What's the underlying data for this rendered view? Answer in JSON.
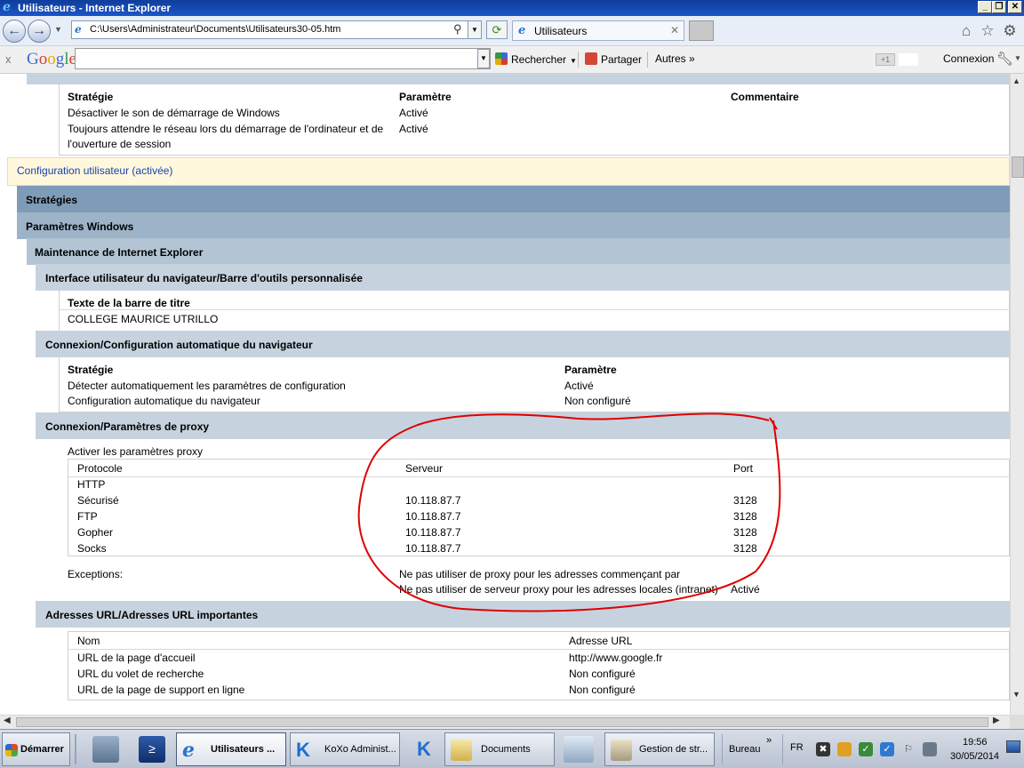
{
  "window": {
    "title": "Utilisateurs - Internet Explorer",
    "controls": {
      "minimize": "_",
      "maximize": "❐",
      "close": "✕"
    }
  },
  "address_bar": {
    "url": "C:\\Users\\Administrateur\\Documents\\Utilisateurs30-05.htm",
    "tab_title": "Utilisateurs",
    "tab_close": "✕",
    "icons": [
      "back-icon",
      "forward-icon",
      "search-icon",
      "refresh-icon",
      "home-icon",
      "star-icon",
      "gear-icon"
    ]
  },
  "google_toolbar": {
    "close": "x",
    "logo": "Google",
    "search_placeholder": "",
    "search_button": "Rechercher",
    "share_button": "Partager",
    "more_button": "Autres »",
    "plus_one": "+1",
    "login_button": "Connexion"
  },
  "report": {
    "top_table": {
      "headers": [
        "Stratégie",
        "Paramètre",
        "Commentaire"
      ],
      "rows": [
        {
          "policy": "Désactiver le son de démarrage de Windows",
          "setting": "Activé"
        },
        {
          "policy_line1": "Toujours attendre le réseau lors du démarrage de l'ordinateur et de",
          "policy_line2": "l'ouverture de session",
          "setting": "Activé"
        }
      ]
    },
    "user_config": "Configuration utilisateur (activée)",
    "strategies": "Stratégies",
    "windows_settings": "Paramètres Windows",
    "ie_maintenance": "Maintenance de Internet Explorer",
    "ui_section": "Interface utilisateur du navigateur/Barre d'outils personnalisée",
    "titlebar_label": "Texte de la barre de titre",
    "titlebar_value": "COLLEGE MAURICE UTRILLO",
    "autoconfig_section": "Connexion/Configuration automatique du navigateur",
    "autoconfig_table": {
      "headers": [
        "Stratégie",
        "Paramètre"
      ],
      "rows": [
        {
          "policy": "Détecter automatiquement les paramètres de configuration",
          "setting": "Activé"
        },
        {
          "policy": "Configuration automatique du navigateur",
          "setting": "Non configuré"
        }
      ]
    },
    "proxy_section": "Connexion/Paramètres de proxy",
    "proxy_enable": "Activer les paramètres proxy",
    "proxy_table": {
      "headers": [
        "Protocole",
        "Serveur",
        "Port"
      ],
      "rows": [
        {
          "protocol": "HTTP",
          "server": "",
          "port": ""
        },
        {
          "protocol": "Sécurisé",
          "server": "10.118.87.7",
          "port": "3128"
        },
        {
          "protocol": "FTP",
          "server": "10.118.87.7",
          "port": "3128"
        },
        {
          "protocol": "Gopher",
          "server": "10.118.87.7",
          "port": "3128"
        },
        {
          "protocol": "Socks",
          "server": "10.118.87.7",
          "port": "3128"
        }
      ]
    },
    "exceptions_label": "Exceptions:",
    "exceptions_line1": "Ne pas utiliser de proxy pour les adresses commençant par",
    "exceptions_line2": "Ne pas utiliser de serveur proxy pour les adresses locales (intranet)",
    "exceptions_line2_value": "Activé",
    "urls_section": "Adresses URL/Adresses URL importantes",
    "urls_table": {
      "headers": [
        "Nom",
        "Adresse URL"
      ],
      "rows": [
        {
          "name": "URL de la page d'accueil",
          "url": "http://www.google.fr"
        },
        {
          "name": "URL du volet de recherche",
          "url": "Non configuré"
        },
        {
          "name": "URL de la page de support en ligne",
          "url": "Non configuré"
        }
      ]
    }
  },
  "taskbar": {
    "start": "Démarrer",
    "buttons": [
      "Utilisateurs ...",
      "KoXo Administ...",
      "Documents",
      "Gestion de str..."
    ],
    "bureau": "Bureau",
    "bureau_chevron": "»",
    "language": "FR",
    "time": "19:56",
    "date": "30/05/2014"
  },
  "colors": {
    "band_dark": "#7e9cb8",
    "band_mid": "#9db3c7",
    "band_light": "#c6d3df",
    "user_config_bg": "#fff8dc",
    "annotation": "#e00000"
  }
}
